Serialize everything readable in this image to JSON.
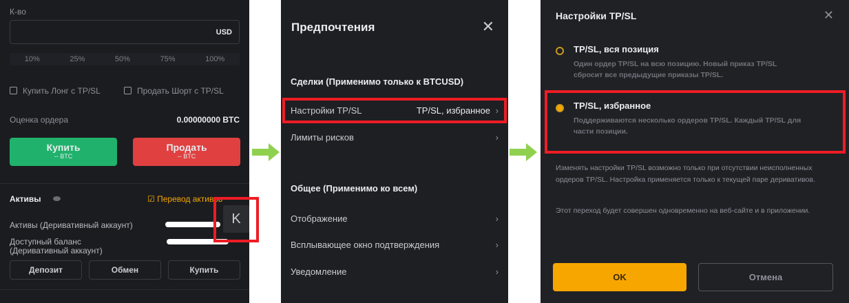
{
  "left": {
    "qty_label": "К-во",
    "currency": "USD",
    "percents": [
      "10%",
      "25%",
      "50%",
      "75%",
      "100%"
    ],
    "long_tpsl": "Купить Лонг с TP/SL",
    "short_tpsl": "Продать Шорт с TP/SL",
    "order_est_label": "Оценка ордера",
    "order_est_value": "0.00000000 BTC",
    "buy_label": "Купить",
    "buy_sub": "-- BTC",
    "sell_label": "Продать",
    "sell_sub": "-- BTC",
    "assets_title": "Активы",
    "transfer_label": "Перевод активов",
    "assets_row": "Активы (Деривативный аккаунт)",
    "avail_row_1": "Доступный баланс",
    "avail_row_2": "(Деривативный аккаунт)",
    "collapse_key": "K",
    "deposit": "Депозит",
    "exchange": "Обмен",
    "buy": "Купить"
  },
  "middle": {
    "title": "Предпочтения",
    "section1": "Сделки (Применимо только к BTCUSD)",
    "tpsl_label": "Настройки TP/SL",
    "tpsl_value": "TP/SL, избранное",
    "risk_limits": "Лимиты рисков",
    "section2": "Общее (Применимо ко всем)",
    "display": "Отображение",
    "confirm_popup": "Всплывающее окно подтверждения",
    "notifications": "Уведомление"
  },
  "right": {
    "title": "Настройки TP/SL",
    "opt1_title": "TP/SL, вся позиция",
    "opt1_desc": "Один ордер TP/SL на всю позицию. Новый приказ TP/SL сбросит все предыдущие приказы TP/SL.",
    "opt2_title": "TP/SL, избранное",
    "opt2_desc": "Поддерживаются несколько ордеров TP/SL. Каждый TP/SL для части позиции.",
    "note1": "Изменять настройки TP/SL возможно только при отсутствии неисполненных ордеров TP/SL. Настройка применяется только к текущей паре деривативов.",
    "note2": "Этот переход будет совершен одновременно на веб-сайте и в приложении.",
    "ok": "OK",
    "cancel": "Отмена",
    "selected_option": 2
  },
  "colors": {
    "buy": "#20b26c",
    "sell": "#e04040",
    "accent": "#f7a600",
    "highlight": "#ee1c25"
  }
}
